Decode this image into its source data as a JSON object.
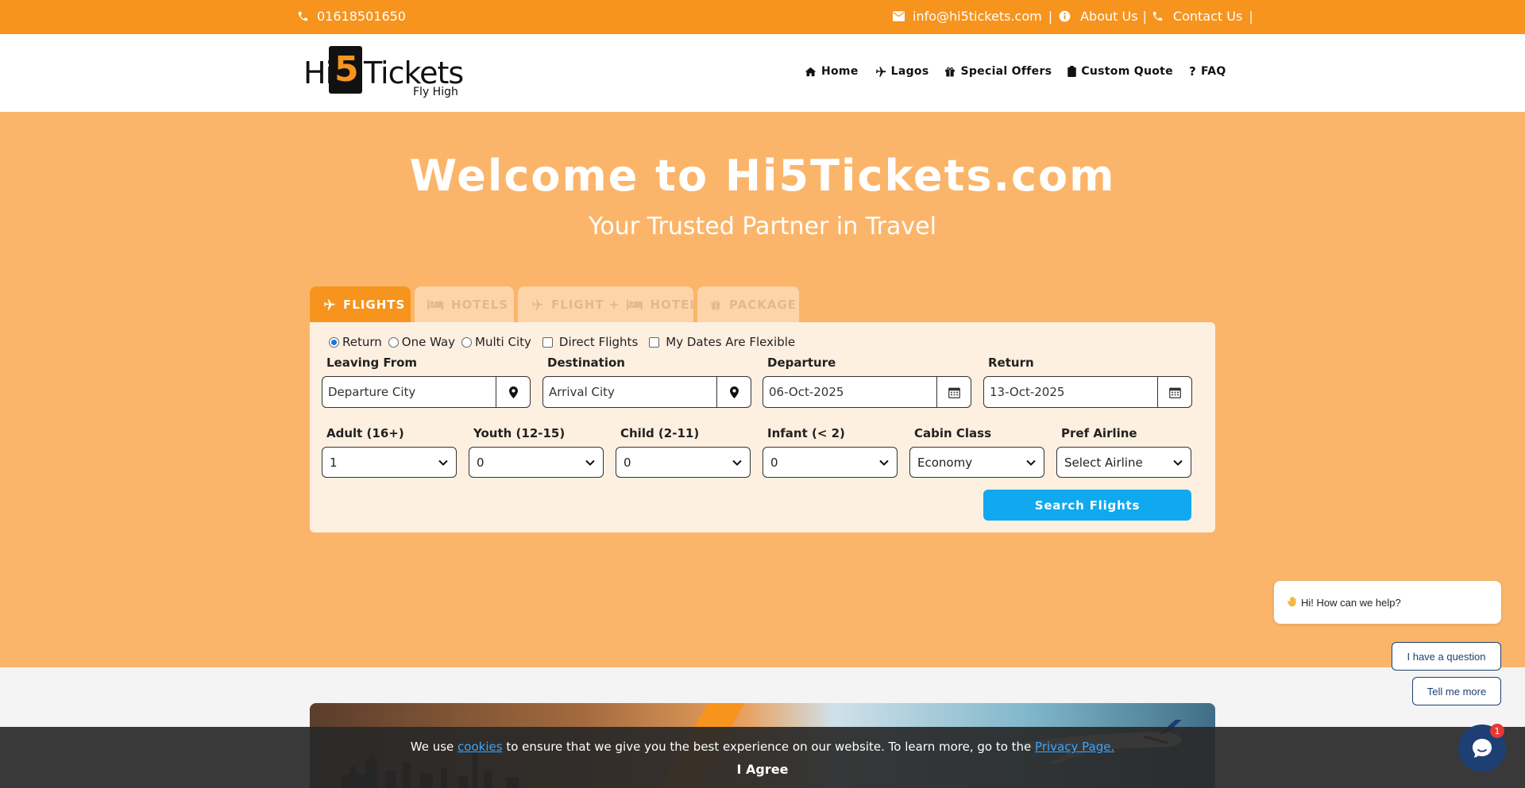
{
  "topbar": {
    "phone": "01618501650",
    "email": "info@hi5tickets.com",
    "about": "About Us",
    "contact": "Contact Us",
    "sep": "|"
  },
  "logo": {
    "text_left": "Hi",
    "five": "5",
    "text_right": "Tickets",
    "tagline": "Fly High"
  },
  "nav": [
    {
      "label": "Home",
      "icon": "home-icon"
    },
    {
      "label": "Lagos",
      "icon": "plane-icon"
    },
    {
      "label": "Special Offers",
      "icon": "gift-icon"
    },
    {
      "label": "Custom Quote",
      "icon": "clipboard-icon"
    },
    {
      "label": "FAQ",
      "icon": "question-icon"
    }
  ],
  "hero": {
    "title": "Welcome to Hi5Tickets.com",
    "subtitle": "Your Trusted Partner in Travel"
  },
  "tabs": [
    {
      "label": "FLIGHTS",
      "active": true
    },
    {
      "label": "HOTELS",
      "active": false
    },
    {
      "label": "FLIGHT + ",
      "label2": "HOTELS",
      "active": false
    },
    {
      "label": "PACKAGE",
      "active": false
    }
  ],
  "trip_options": {
    "return": "Return",
    "one_way": "One Way",
    "multi_city": "Multi City",
    "direct": "Direct Flights",
    "flexible": "My Dates Are Flexible",
    "selected": "Return"
  },
  "fields": {
    "leaving_label": "Leaving From",
    "leaving_placeholder": "Departure City",
    "destination_label": "Destination",
    "destination_placeholder": "Arrival City",
    "departure_label": "Departure",
    "departure_value": "06-Oct-2025",
    "return_label": "Return",
    "return_value": "13-Oct-2025"
  },
  "selects": [
    {
      "label": "Adult (16+)",
      "value": "1"
    },
    {
      "label": "Youth (12-15)",
      "value": "0"
    },
    {
      "label": "Child (2-11)",
      "value": "0"
    },
    {
      "label": "Infant (< 2)",
      "value": "0"
    },
    {
      "label": "Cabin Class",
      "value": "Economy"
    },
    {
      "label": "Pref Airline",
      "value": "Select Airline"
    }
  ],
  "search_button": "Search Flights",
  "chat": {
    "greeting": "Hi! How can we help?",
    "btn_question": "I have a question",
    "btn_more": "Tell me more",
    "unread": "1"
  },
  "cookie": {
    "pre": "We use ",
    "link": "cookies",
    "mid": " to ensure that we give you the best experience on our website. To learn more, go to the ",
    "privacy": "Privacy Page.",
    "agree": "I Agree"
  },
  "colors": {
    "brand_orange": "#f7941d",
    "hero_bg": "#fbb56a",
    "search_blue": "#10a9f0",
    "chat_navy": "#1e3f73"
  }
}
